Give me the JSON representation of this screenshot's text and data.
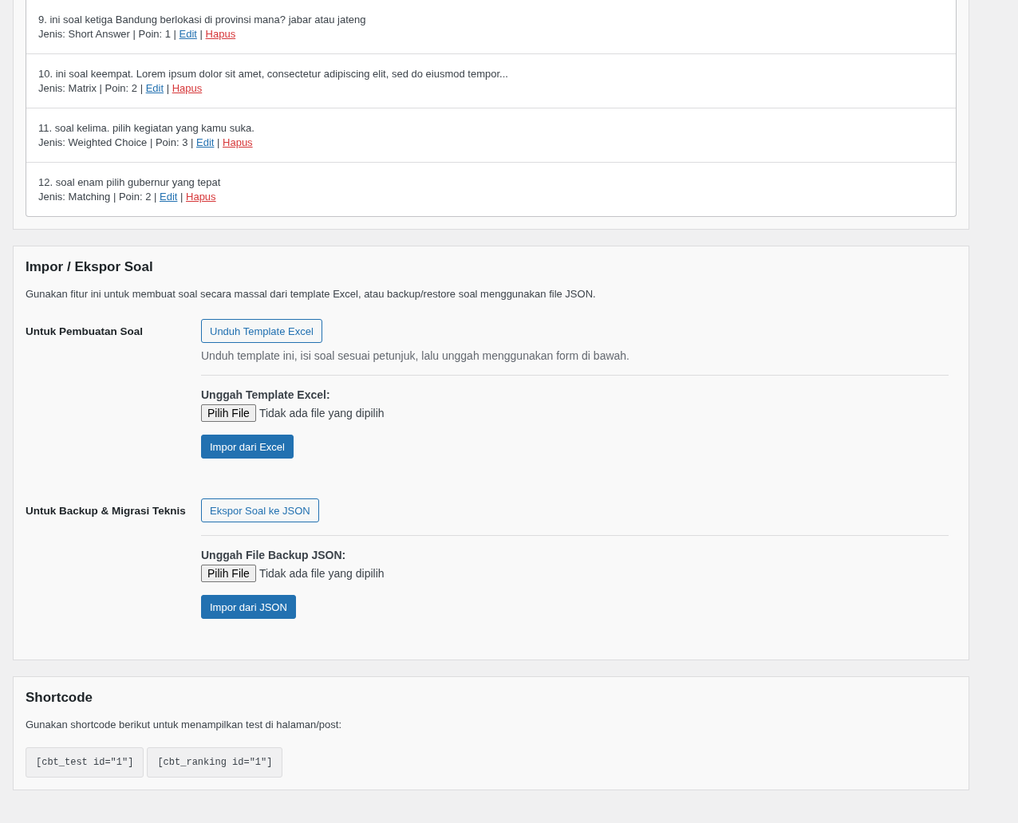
{
  "questions": [
    {
      "text": "9. ini soal ketiga Bandung berlokasi di provinsi mana? jabar atau jateng",
      "meta": "Jenis: Short Answer | Poin: 1 |",
      "separator": "|",
      "edit": "Edit",
      "delete": "Hapus"
    },
    {
      "text": "10. ini soal keempat. Lorem ipsum dolor sit amet, consectetur adipiscing elit, sed do eiusmod tempor...",
      "meta": "Jenis: Matrix | Poin: 2 |",
      "separator": "|",
      "edit": "Edit",
      "delete": "Hapus"
    },
    {
      "text": "11. soal kelima. pilih kegiatan yang kamu suka.",
      "meta": "Jenis: Weighted Choice | Poin: 3 |",
      "separator": "|",
      "edit": "Edit",
      "delete": "Hapus"
    },
    {
      "text": "12. soal enam pilih gubernur yang tepat",
      "meta": "Jenis: Matching | Poin: 2 |",
      "separator": "|",
      "edit": "Edit",
      "delete": "Hapus"
    }
  ],
  "import_export": {
    "title": "Impor / Ekspor Soal",
    "description": "Gunakan fitur ini untuk membuat soal secara massal dari template Excel, atau backup/restore soal menggunakan file JSON.",
    "rows": [
      {
        "label": "Untuk Pembuatan Soal",
        "action_button": "Unduh Template Excel",
        "help": "Unduh template ini, isi soal sesuai petunjuk, lalu unggah menggunakan form di bawah.",
        "upload_label": "Unggah Template Excel:",
        "file_button": "Pilih File",
        "file_status": "Tidak ada file yang dipilih",
        "submit_button": "Impor dari Excel"
      },
      {
        "label": "Untuk Backup & Migrasi Teknis",
        "action_button": "Ekspor Soal ke JSON",
        "upload_label": "Unggah File Backup JSON:",
        "file_button": "Pilih File",
        "file_status": "Tidak ada file yang dipilih",
        "submit_button": "Impor dari JSON"
      }
    ]
  },
  "shortcode": {
    "title": "Shortcode",
    "description": "Gunakan shortcode berikut untuk menampilkan test di halaman/post:",
    "codes": [
      "[cbt_test id=\"1\"]",
      "[cbt_ranking id=\"1\"]"
    ]
  }
}
